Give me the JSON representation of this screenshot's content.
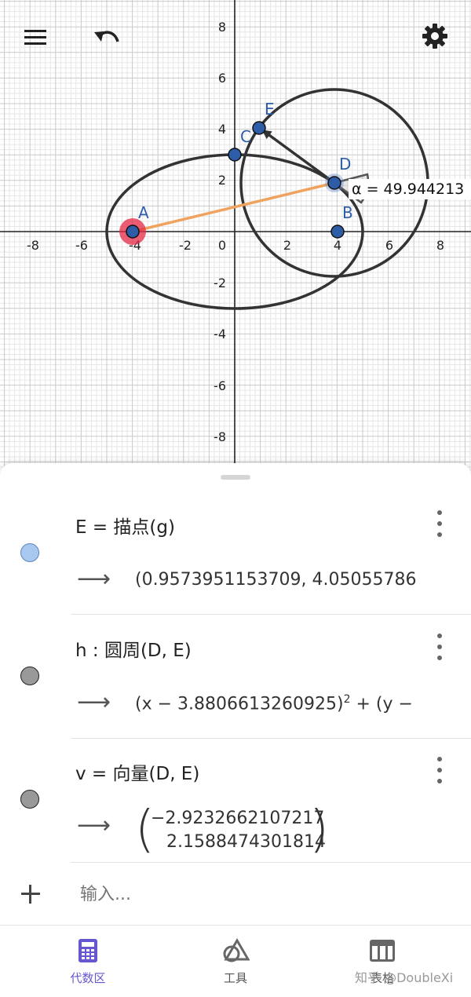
{
  "toolbar": {
    "menu_icon": "hamburger-menu-icon",
    "undo_icon": "undo-icon",
    "settings_icon": "gear-icon"
  },
  "graph": {
    "x_ticks": [
      "-8",
      "-6",
      "-4",
      "-2",
      "0",
      "2",
      "4",
      "6",
      "8"
    ],
    "y_ticks": [
      "8",
      "6",
      "4",
      "2",
      "-2",
      "-4",
      "-6",
      "-8"
    ],
    "points": {
      "A": "A",
      "B": "B",
      "C": "C",
      "D": "D",
      "E": "E"
    },
    "angle_label": "α = 49.944213"
  },
  "algebra": {
    "rows": [
      {
        "definition": "E  =  描点(g)",
        "value": "(0.9573951153709, 4.05055786",
        "dot_color": "#a9c8f0"
      },
      {
        "definition": "h :  圆周(D,  E)",
        "value_main": "(x − 3.8806613260925)",
        "value_exp": "2",
        "value_rest": " + (y −",
        "dot_color": "#999999"
      },
      {
        "definition": "v  =  向量(D,  E)",
        "value_top": "−2.9232662107217",
        "value_bottom": "2.1588474301814",
        "dot_color": "#999999"
      }
    ],
    "input_placeholder": "输入...",
    "add_icon": "plus-icon"
  },
  "bottom_nav": {
    "items": [
      {
        "label": "代数区",
        "icon": "calculator-icon",
        "active": true
      },
      {
        "label": "工具",
        "icon": "shapes-tool-icon",
        "active": false
      },
      {
        "label": "表格",
        "icon": "table-icon",
        "active": false
      }
    ],
    "accent": "#6557d2"
  },
  "watermark": "知乎 @DoubleXi"
}
